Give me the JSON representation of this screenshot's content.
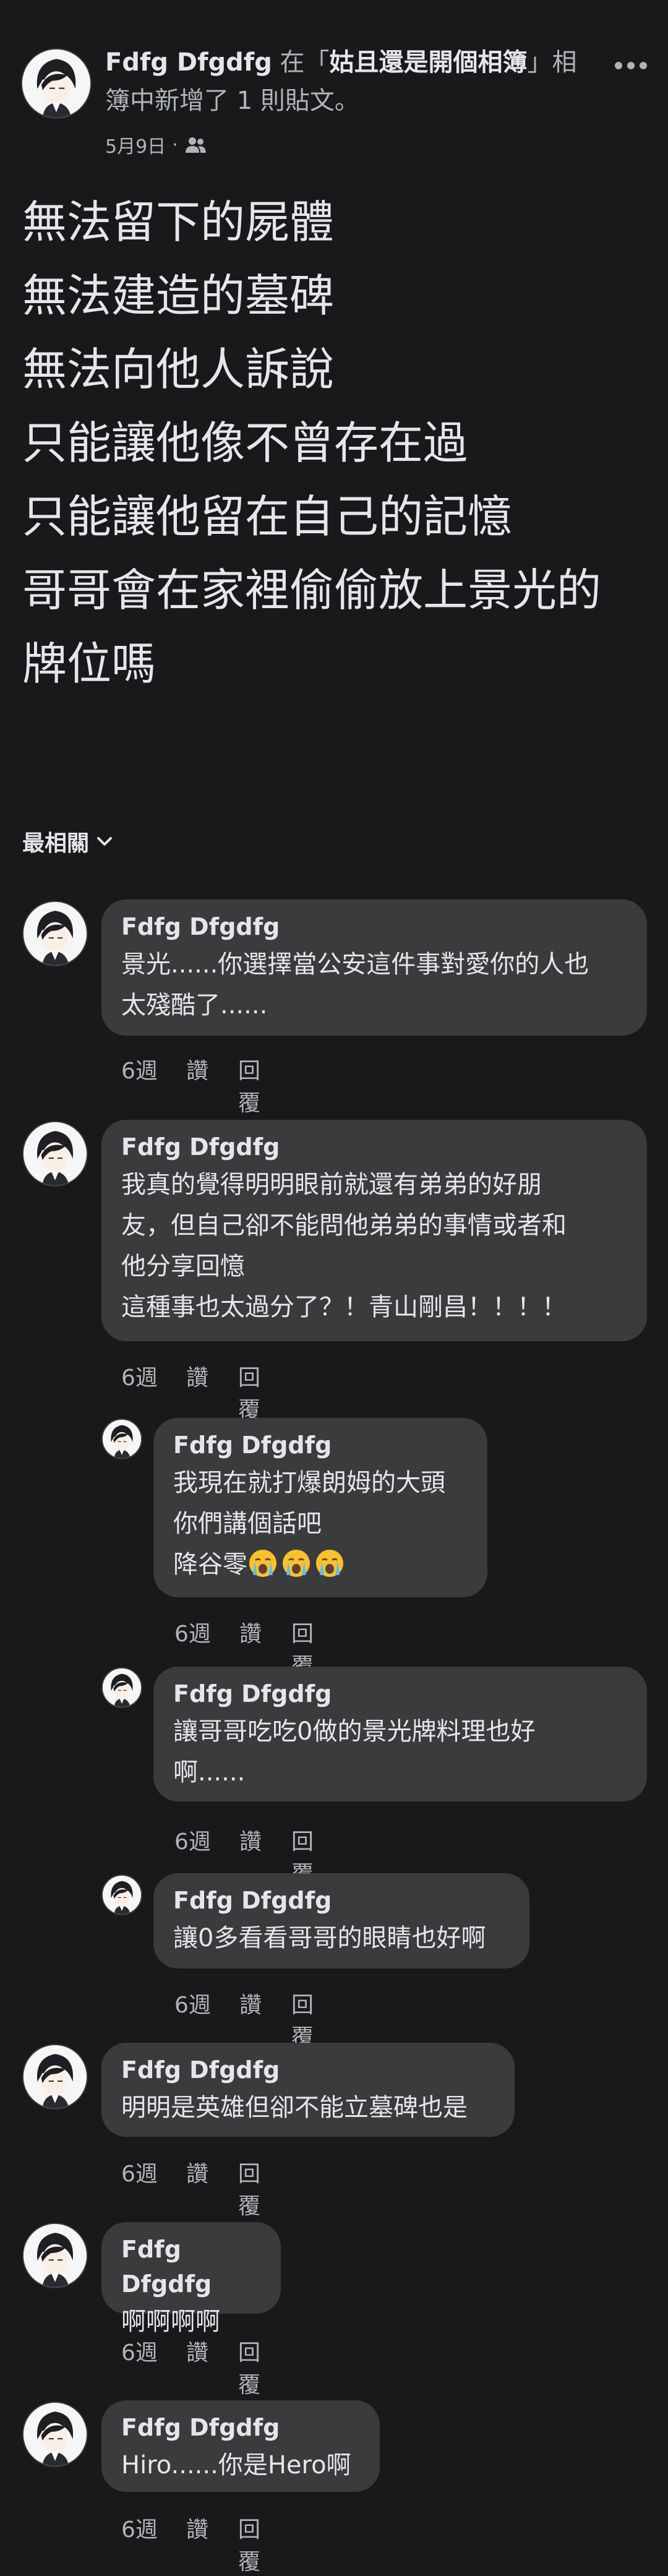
{
  "header": {
    "author": "Fdfg Dfgdfg",
    "text_before": " 在「",
    "album": "姑且還是開個相簿",
    "text_after": "」相簿中新增了 1 則貼文。",
    "date": "5月9日",
    "separator": "·",
    "privacy_icon": "friends-icon",
    "more_icon": "more-horizontal-icon"
  },
  "post": {
    "lines": [
      "無法留下的屍體",
      "無法建造的墓碑",
      "無法向他人訴說",
      "只能讓他像不曾存在過",
      "只能讓他留在自己的記憶",
      "哥哥會在家裡偷偷放上景光的",
      "牌位嗎"
    ]
  },
  "sort": {
    "label": "最相關",
    "icon": "chevron-down-icon"
  },
  "actions": {
    "time": "6週",
    "like": "讚",
    "reply": "回覆"
  },
  "comments": [
    {
      "name": "Fdfg Dfgdfg",
      "lines": [
        "景光......你選擇當公安這件事對愛你的人也",
        "太殘酷了......"
      ]
    },
    {
      "name": "Fdfg Dfgdfg",
      "lines": [
        "我真的覺得明明眼前就還有弟弟的好朋",
        "友，但自己卻不能問他弟弟的事情或者和",
        "他分享回憶",
        "這種事也太過分了？！青山剛昌！！！！"
      ]
    },
    {
      "name": "Fdfg Dfgdfg",
      "lines": [
        "我現在就打爆朗姆的大頭",
        "你們講個話吧",
        "降谷零"
      ],
      "emoji": "crying-face-emoji"
    },
    {
      "name": "Fdfg Dfgdfg",
      "lines": [
        "讓哥哥吃吃0做的景光牌料理也好",
        "啊......"
      ]
    },
    {
      "name": "Fdfg Dfgdfg",
      "lines": [
        "讓0多看看哥哥的眼睛也好啊"
      ]
    },
    {
      "name": "Fdfg Dfgdfg",
      "lines": [
        "明明是英雄但卻不能立墓碑也是"
      ]
    },
    {
      "name": "Fdfg Dfgdfg",
      "lines": [
        "啊啊啊啊"
      ]
    },
    {
      "name": "Fdfg Dfgdfg",
      "lines": [
        "Hiro......你是Hero啊"
      ]
    }
  ]
}
